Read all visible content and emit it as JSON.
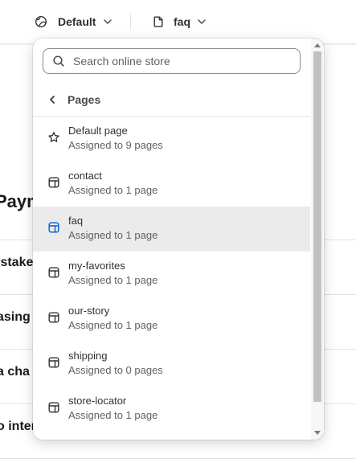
{
  "topbar": {
    "theme_selector": {
      "label": "Default",
      "icon": "globe-icon"
    },
    "page_selector": {
      "label": "faq",
      "icon": "page-icon"
    }
  },
  "background": {
    "heading": "Paym",
    "rows": [
      "istake",
      "asing",
      "a cha",
      "o inter"
    ]
  },
  "popover": {
    "search": {
      "placeholder": "Search online store",
      "value": ""
    },
    "back": {
      "label": "Pages"
    },
    "items": [
      {
        "name": "Default page",
        "sub": "Assigned to 9 pages",
        "icon": "star-icon",
        "selected": false
      },
      {
        "name": "contact",
        "sub": "Assigned to 1 page",
        "icon": "template-icon",
        "selected": false
      },
      {
        "name": "faq",
        "sub": "Assigned to 1 page",
        "icon": "template-icon",
        "selected": true
      },
      {
        "name": "my-favorites",
        "sub": "Assigned to 1 page",
        "icon": "template-icon",
        "selected": false
      },
      {
        "name": "our-story",
        "sub": "Assigned to 1 page",
        "icon": "template-icon",
        "selected": false
      },
      {
        "name": "shipping",
        "sub": "Assigned to 0 pages",
        "icon": "template-icon",
        "selected": false
      },
      {
        "name": "store-locator",
        "sub": "Assigned to 1 page",
        "icon": "template-icon",
        "selected": false
      }
    ]
  },
  "colors": {
    "selected_icon": "#005bd3",
    "selected_bg": "#ebebeb",
    "icon": "#4a4a4a"
  }
}
